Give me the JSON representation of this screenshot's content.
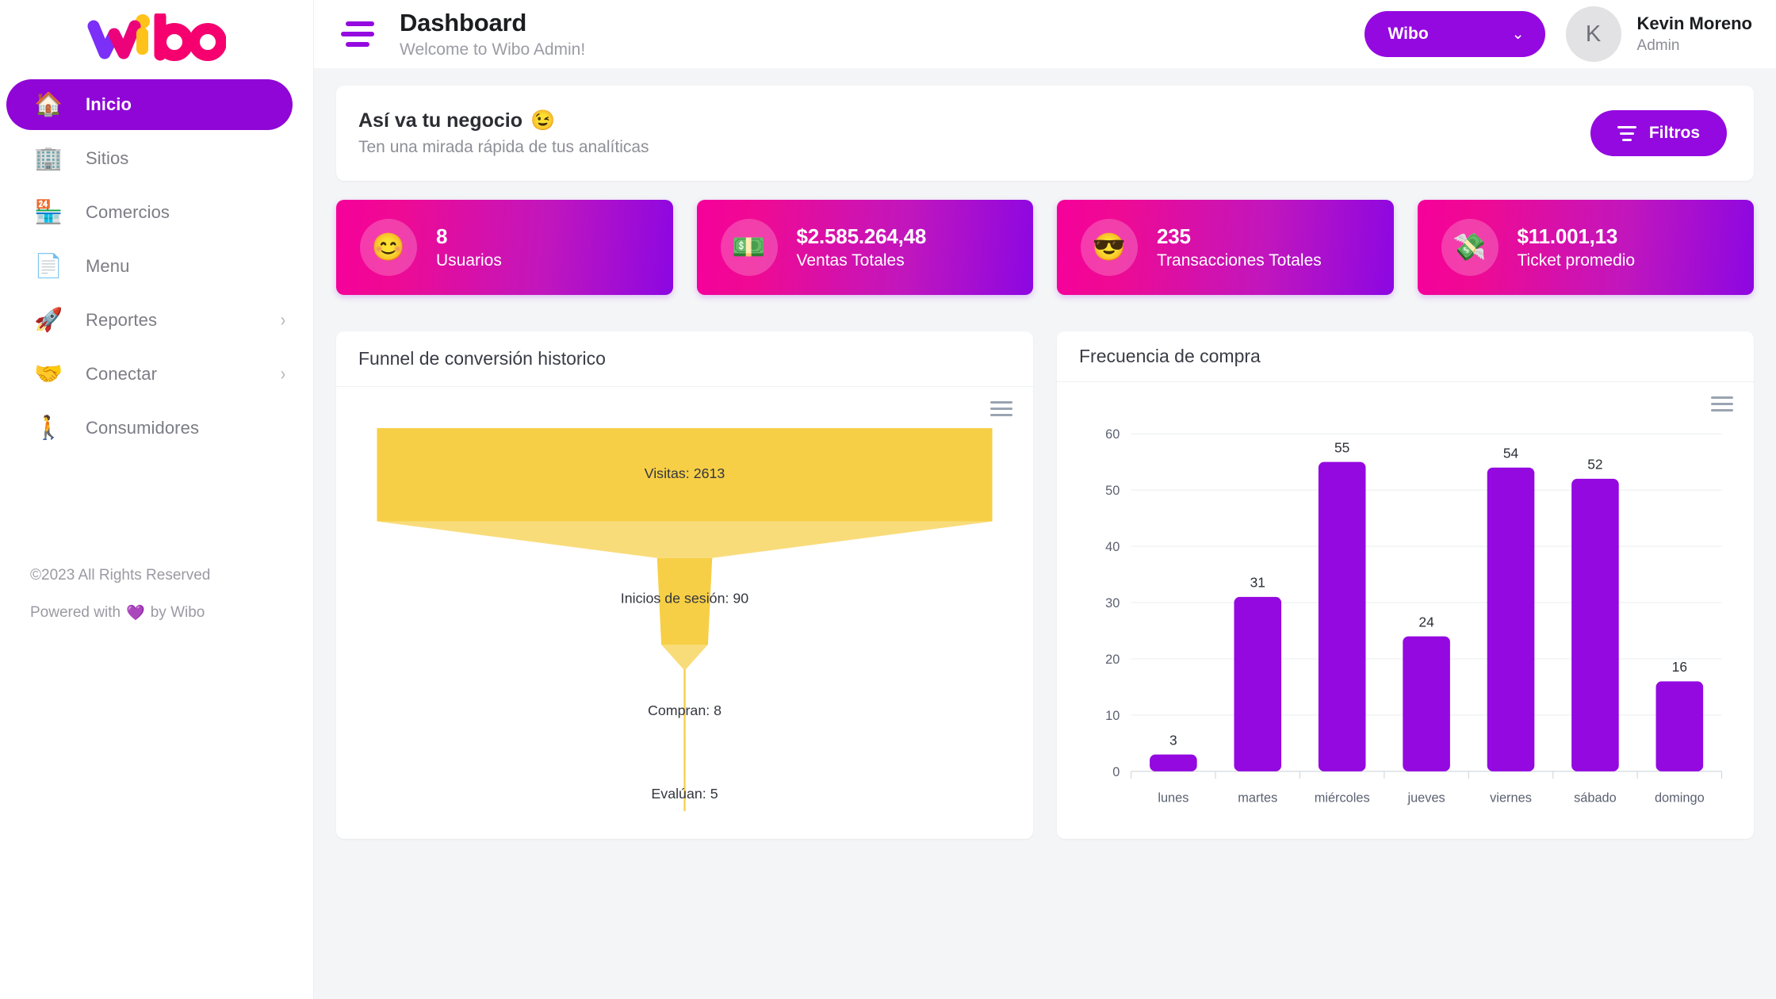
{
  "brand": {
    "name": "Wibo",
    "logo_colors": {
      "purple": "#7b2ff7",
      "pink": "#f5006e",
      "yellow": "#ffc21a"
    }
  },
  "sidebar": {
    "items": [
      {
        "label": "Inicio",
        "icon": "house-icon",
        "glyph": "🏠",
        "active": true,
        "chevron": false
      },
      {
        "label": "Sitios",
        "icon": "office-building-icon",
        "glyph": "🏢",
        "active": false,
        "chevron": false
      },
      {
        "label": "Comercios",
        "icon": "convenience-store-icon",
        "glyph": "🏪",
        "active": false,
        "chevron": false
      },
      {
        "label": "Menu",
        "icon": "page-document-icon",
        "glyph": "📄",
        "active": false,
        "chevron": false
      },
      {
        "label": "Reportes",
        "icon": "rocket-icon",
        "glyph": "🚀",
        "active": false,
        "chevron": true
      },
      {
        "label": "Conectar",
        "icon": "handshake-icon",
        "glyph": "🤝",
        "active": false,
        "chevron": true
      },
      {
        "label": "Consumidores",
        "icon": "walking-person-icon",
        "glyph": "🚶",
        "active": false,
        "chevron": false
      }
    ],
    "chevron_glyph": "›",
    "footer": {
      "copyright": "©2023 All Rights Reserved",
      "powered_prefix": "Powered with",
      "powered_heart": "💜",
      "powered_suffix": "by Wibo"
    }
  },
  "topbar": {
    "menu_toggle": "hamburger-menu",
    "title": "Dashboard",
    "subtitle": "Welcome to Wibo Admin!",
    "org_select": {
      "value": "Wibo",
      "chevron": "⌄"
    },
    "user": {
      "initial": "K",
      "name": "Kevin Moreno",
      "role": "Admin"
    }
  },
  "banner": {
    "title": "Así va tu negocio",
    "title_emoji": "😉",
    "subtitle": "Ten una mirada rápida de tus analíticas",
    "filters_label": "Filtros"
  },
  "kpis": [
    {
      "value": "8",
      "label": "Usuarios",
      "icon": "smiling-face-icon",
      "glyph": "😊"
    },
    {
      "value": "$2.585.264,48",
      "label": "Ventas Totales",
      "icon": "dollar-banknote-icon",
      "glyph": "💵"
    },
    {
      "value": "235",
      "label": "Transacciones Totales",
      "icon": "sunglasses-face-icon",
      "glyph": "😎"
    },
    {
      "value": "$11.001,13",
      "label": "Ticket promedio",
      "icon": "money-with-wings-icon",
      "glyph": "💸"
    }
  ],
  "charts": {
    "funnel": {
      "title": "Funnel de conversión historico",
      "export_icon": "export-menu-icon"
    },
    "bars": {
      "title": "Frecuencia de compra",
      "export_icon": "export-menu-icon"
    }
  },
  "chart_data": [
    {
      "type": "funnel",
      "title": "Funnel de conversión historico",
      "color": "#f7cf46",
      "stages": [
        {
          "name": "Visitas",
          "value": 2613,
          "label": "Visitas: 2613"
        },
        {
          "name": "Inicios de sesión",
          "value": 90,
          "label": "Inicios de sesión: 90"
        },
        {
          "name": "Compran",
          "value": 8,
          "label": "Compran: 8"
        },
        {
          "name": "Evalúan",
          "value": 5,
          "label": "Evalúan: 5"
        }
      ]
    },
    {
      "type": "bar",
      "title": "Frecuencia de compra",
      "categories": [
        "lunes",
        "martes",
        "miércoles",
        "jueves",
        "viernes",
        "sábado",
        "domingo"
      ],
      "values": [
        3,
        31,
        55,
        24,
        54,
        52,
        16
      ],
      "yticks": [
        0,
        10,
        20,
        30,
        40,
        50,
        60
      ],
      "ylim": [
        0,
        62
      ],
      "xlabel": "",
      "ylabel": "",
      "grid": true,
      "legend": false,
      "bar_color": "#9409e0"
    }
  ]
}
